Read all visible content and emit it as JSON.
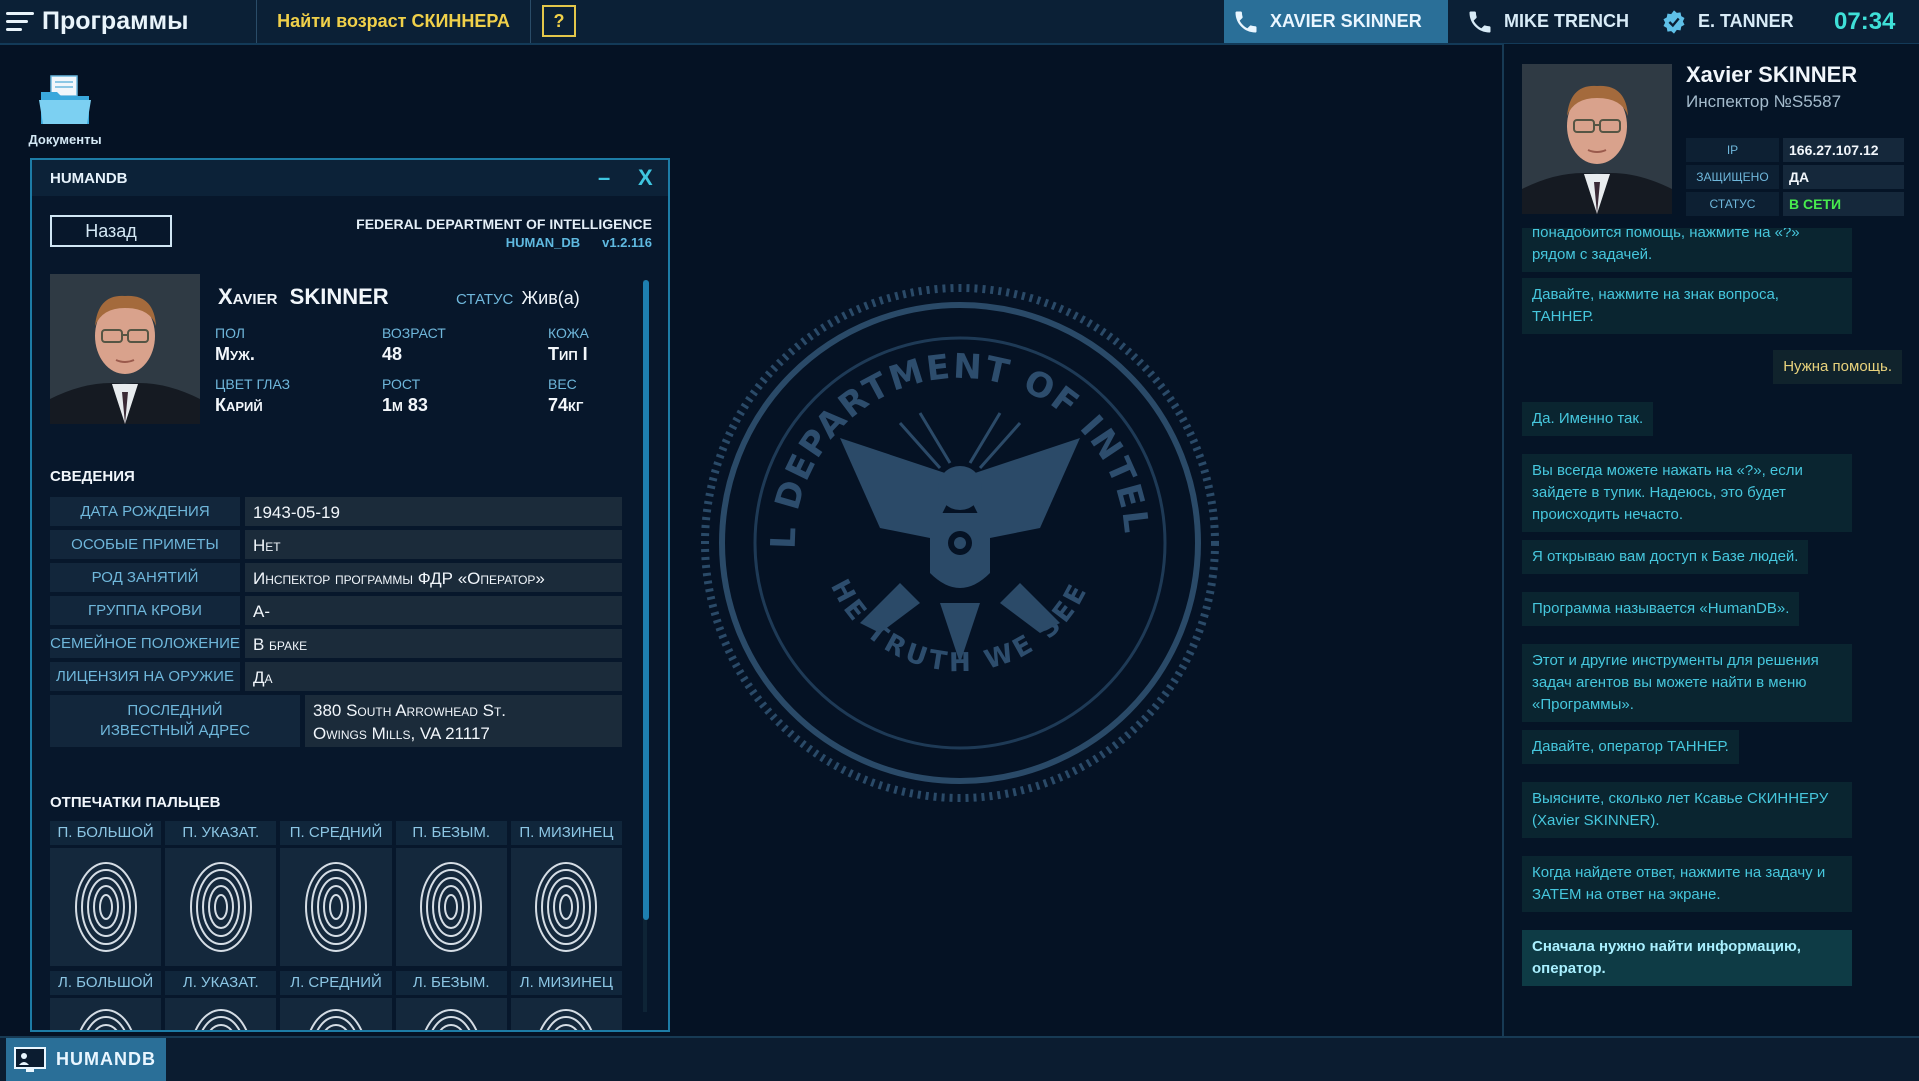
{
  "topbar": {
    "menu_label": "Программы",
    "task_label": "Найти возраст СКИННЕРА",
    "help_label": "?",
    "contacts": [
      {
        "name": "XAVIER SKINNER",
        "icon": "phone-icon",
        "active": true
      },
      {
        "name": "MIKE TRENCH",
        "icon": "phone-icon",
        "active": false
      },
      {
        "name": "E. TANNER",
        "icon": "badge-icon",
        "active": false
      }
    ],
    "clock": "07:34"
  },
  "desktop": {
    "documents_label": "Документы",
    "seal": {
      "top_text": "FEDERAL DEPARTMENT OF INTELLIGENCE",
      "bottom_text": "THE TRUTH WE SEEK"
    }
  },
  "window": {
    "title": "HUMANDB",
    "minimize": "–",
    "close": "X",
    "back_label": "Назад",
    "org_name": "FEDERAL DEPARTMENT OF INTELLIGENCE",
    "db_name": "HUMAN_DB",
    "version": "v1.2.116",
    "person": {
      "first_name": "Xavier",
      "last_name": "SKINNER",
      "status_label": "СТАТУС",
      "status_value": "Жив(а)",
      "attrs": [
        {
          "label": "ПОЛ",
          "value": "Муж."
        },
        {
          "label": "ВОЗРАСТ",
          "value": "48"
        },
        {
          "label": "КОЖА",
          "value": "Тип I"
        },
        {
          "label": "ЦВЕТ ГЛАЗ",
          "value": "Карий"
        },
        {
          "label": "РОСТ",
          "value": "1м 83"
        },
        {
          "label": "ВЕС",
          "value": "74кг"
        }
      ]
    },
    "info_title": "СВЕДЕНИЯ",
    "info_rows": [
      {
        "label": "ДАТА РОЖДЕНИЯ",
        "value": "1943-05-19"
      },
      {
        "label": "ОСОБЫЕ ПРИМЕТЫ",
        "value": "Нет"
      },
      {
        "label": "РОД ЗАНЯТИЙ",
        "value": "Инспектор программы ФДР «Оператор»"
      },
      {
        "label": "ГРУППА КРОВИ",
        "value": "A-"
      },
      {
        "label": "СЕМЕЙНОЕ ПОЛОЖЕНИЕ",
        "value": "В браке"
      },
      {
        "label": "ЛИЦЕНЗИЯ НА ОРУЖИЕ",
        "value": "Да"
      },
      {
        "label": "ПОСЛЕДНИЙ ИЗВЕСТНЫЙ АДРЕС",
        "value": "380 South Arrowhead St.",
        "value2": "Owings Mills, VA 21117"
      }
    ],
    "fingerprints_title": "ОТПЕЧАТКИ ПАЛЬЦЕВ",
    "fp_right": [
      "П. БОЛЬШОЙ",
      "П. УКАЗАТ.",
      "П. СРЕДНИЙ",
      "П. БЕЗЫМ.",
      "П. МИЗИНЕЦ"
    ],
    "fp_left": [
      "Л. БОЛЬШОЙ",
      "Л. УКАЗАТ.",
      "Л. СРЕДНИЙ",
      "Л. БЕЗЫМ.",
      "Л. МИЗИНЕЦ"
    ]
  },
  "profile": {
    "name": "Xavier SKINNER",
    "subtitle": "Инспектор №S5587",
    "rows": [
      {
        "label": "IP",
        "value": "166.27.107.12"
      },
      {
        "label": "ЗАЩИЩЕНО",
        "value": "ДА"
      },
      {
        "label": "СТАТУС",
        "value": "В СЕТИ"
      }
    ]
  },
  "chat": [
    {
      "from": "them",
      "text": "понадобится помощь, нажмите на «?» рядом с задачей."
    },
    {
      "from": "them",
      "text": "Давайте, нажмите на знак вопроса, ТАННЕР."
    },
    {
      "from": "me",
      "text": "Нужна помощь."
    },
    {
      "from": "them",
      "text": "Да. Именно так."
    },
    {
      "from": "them",
      "text": "Вы всегда можете нажать на «?», если зайдете в тупик. Надеюсь, это будет происходить нечасто."
    },
    {
      "from": "them",
      "text": "Я открываю вам доступ к Базе людей."
    },
    {
      "from": "them",
      "text": "Программа называется «HumanDB»."
    },
    {
      "from": "them",
      "text": "Этот и другие инструменты для решения задач агентов вы можете найти в меню «Программы»."
    },
    {
      "from": "them",
      "text": "Давайте, оператор ТАННЕР."
    },
    {
      "from": "them",
      "text": "Выясните, сколько лет Ксавье СКИННЕРУ (Xavier SKINNER)."
    },
    {
      "from": "them",
      "text": "Когда найдете ответ, нажмите на задачу и ЗАТЕМ на ответ на экране."
    },
    {
      "from": "them",
      "text": "Сначала нужно найти информацию, оператор.",
      "highlight": true
    }
  ],
  "taskbar": {
    "item_label": "HUMANDB"
  }
}
